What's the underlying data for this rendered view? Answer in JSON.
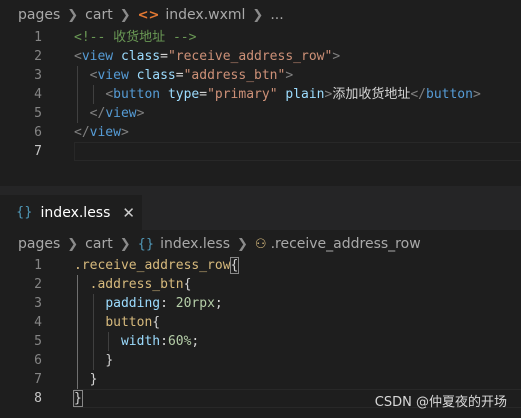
{
  "top_breadcrumb": {
    "segments": [
      "pages",
      "cart",
      "index.wxml",
      "..."
    ],
    "file_icon": "xml-angle-brackets-icon"
  },
  "wxml_lines": [
    {
      "n": "1",
      "parts": [
        [
          "comm",
          "<!-- 收货地址 -->"
        ]
      ]
    },
    {
      "n": "2",
      "parts": [
        [
          "punc",
          "<"
        ],
        [
          "tag",
          "view"
        ],
        [
          "t",
          " "
        ],
        [
          "attr",
          "class"
        ],
        [
          "t",
          "="
        ],
        [
          "str",
          "\"receive_address_row\""
        ],
        [
          "punc",
          ">"
        ]
      ]
    },
    {
      "n": "3",
      "parts": [
        [
          "t",
          "  "
        ],
        [
          "punc",
          "<"
        ],
        [
          "tag",
          "view"
        ],
        [
          "t",
          " "
        ],
        [
          "attr",
          "class"
        ],
        [
          "t",
          "="
        ],
        [
          "str",
          "\"address_btn\""
        ],
        [
          "punc",
          ">"
        ]
      ]
    },
    {
      "n": "4",
      "parts": [
        [
          "t",
          "    "
        ],
        [
          "punc",
          "<"
        ],
        [
          "tag",
          "button"
        ],
        [
          "t",
          " "
        ],
        [
          "attr",
          "type"
        ],
        [
          "t",
          "="
        ],
        [
          "str",
          "\"primary\""
        ],
        [
          "t",
          " "
        ],
        [
          "attr",
          "plain"
        ],
        [
          "punc",
          ">"
        ],
        [
          "t",
          "添加收货地址"
        ],
        [
          "punc",
          "</"
        ],
        [
          "tag",
          "button"
        ],
        [
          "punc",
          ">"
        ]
      ]
    },
    {
      "n": "5",
      "parts": [
        [
          "t",
          "  "
        ],
        [
          "punc",
          "</"
        ],
        [
          "tag",
          "view"
        ],
        [
          "punc",
          ">"
        ]
      ]
    },
    {
      "n": "6",
      "parts": [
        [
          "punc",
          "</"
        ],
        [
          "tag",
          "view"
        ],
        [
          "punc",
          ">"
        ]
      ]
    },
    {
      "n": "7",
      "parts": []
    }
  ],
  "tab": {
    "label": "index.less",
    "close": "✕",
    "icon": "less-braces-icon"
  },
  "bottom_breadcrumb": {
    "segments": [
      "pages",
      "cart",
      "index.less",
      ".receive_address_row"
    ],
    "symbol_icon": "symbol-class-icon"
  },
  "less_lines": [
    {
      "n": "1",
      "parts": [
        [
          "sel",
          ".receive_address_row"
        ],
        [
          "br",
          "{"
        ]
      ]
    },
    {
      "n": "2",
      "parts": [
        [
          "t",
          "  "
        ],
        [
          "sel",
          ".address_btn"
        ],
        [
          "t",
          "{"
        ]
      ]
    },
    {
      "n": "3",
      "parts": [
        [
          "t",
          "    "
        ],
        [
          "prop",
          "padding"
        ],
        [
          "t",
          ": "
        ],
        [
          "num",
          "20rpx"
        ],
        [
          "t",
          ";"
        ]
      ]
    },
    {
      "n": "4",
      "parts": [
        [
          "t",
          "    "
        ],
        [
          "sel",
          "button"
        ],
        [
          "t",
          "{"
        ]
      ]
    },
    {
      "n": "5",
      "parts": [
        [
          "t",
          "      "
        ],
        [
          "prop",
          "width"
        ],
        [
          "t",
          ":"
        ],
        [
          "num",
          "60%"
        ],
        [
          "t",
          ";"
        ]
      ]
    },
    {
      "n": "6",
      "parts": [
        [
          "t",
          "    "
        ],
        [
          "t",
          "}"
        ]
      ]
    },
    {
      "n": "7",
      "parts": [
        [
          "t",
          "  "
        ],
        [
          "t",
          "}"
        ]
      ]
    },
    {
      "n": "8",
      "parts": [
        [
          "br",
          "}"
        ]
      ]
    }
  ],
  "watermark": "CSDN @仲夏夜的开场",
  "colors": {
    "bg": "#1e1e1e",
    "tag": "#569cd6",
    "attr": "#9cdcfe",
    "string": "#ce9178",
    "comment": "#6a9955",
    "selector": "#d7ba7d",
    "number": "#b5cea8"
  }
}
